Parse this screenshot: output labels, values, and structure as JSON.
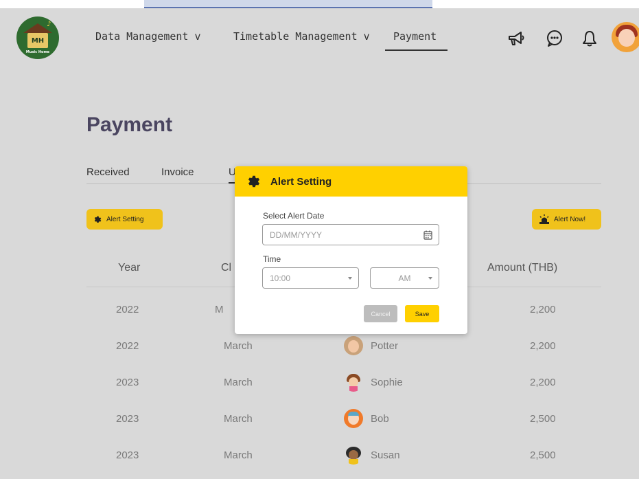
{
  "logo": {
    "initials": "MH",
    "subtitle": "Music Home"
  },
  "nav": {
    "items": [
      {
        "label": "Data Management v"
      },
      {
        "label": "Timetable Management v"
      },
      {
        "label": "Payment"
      }
    ],
    "icons": [
      "megaphone-icon",
      "chat-icon",
      "bell-icon"
    ]
  },
  "page": {
    "title": "Payment",
    "tabs": [
      {
        "label": "Received"
      },
      {
        "label": "Invoice"
      },
      {
        "label": "U"
      }
    ],
    "alert_setting_label": "Alert Setting",
    "alert_now_label": "Alert Now!"
  },
  "table": {
    "headers": {
      "year": "Year",
      "class": "Cl",
      "amount": "Amount (THB)"
    },
    "rows": [
      {
        "year": "2022",
        "class": "M",
        "student": "",
        "amount": "2,200"
      },
      {
        "year": "2022",
        "class": "March",
        "student": "Potter",
        "amount": "2,200"
      },
      {
        "year": "2023",
        "class": "March",
        "student": "Sophie",
        "amount": "2,200"
      },
      {
        "year": "2023",
        "class": "March",
        "student": "Bob",
        "amount": "2,500"
      },
      {
        "year": "2023",
        "class": "March",
        "student": "Susan",
        "amount": "2,500"
      }
    ]
  },
  "modal": {
    "title": "Alert Setting",
    "date_label": "Select Alert Date",
    "date_placeholder": "DD/MM/YYYY",
    "time_label": "Time",
    "time_value": "10:00",
    "ampm_value": "AM",
    "cancel_label": "Cancel",
    "save_label": "Save"
  },
  "colors": {
    "accent_yellow": "#ffd000",
    "button_yellow": "#f0c21b",
    "background": "#d9d9d9",
    "logo_green": "#2e6b2f"
  }
}
